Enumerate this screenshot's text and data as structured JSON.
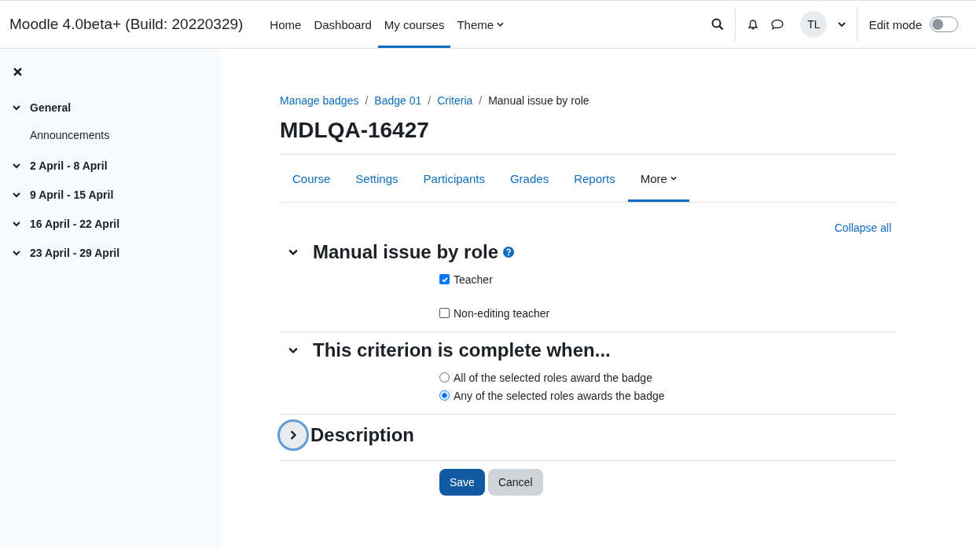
{
  "navbar": {
    "site_name": "Moodle 4.0beta+ (Build: 20220329)",
    "links": [
      {
        "label": "Home",
        "selected": false,
        "dropdown": false
      },
      {
        "label": "Dashboard",
        "selected": false,
        "dropdown": false
      },
      {
        "label": "My courses",
        "selected": true,
        "dropdown": false
      },
      {
        "label": "Theme",
        "selected": false,
        "dropdown": true
      }
    ],
    "avatar_initials": "TL",
    "edit_mode": {
      "label": "Edit mode",
      "on": false
    }
  },
  "drawer": {
    "items": [
      {
        "label": "General",
        "kind": "section",
        "expanded": true
      },
      {
        "label": "Announcements",
        "kind": "activity"
      },
      {
        "label": "2 April - 8 April",
        "kind": "section",
        "expanded": true
      },
      {
        "label": "9 April - 15 April",
        "kind": "section",
        "expanded": true
      },
      {
        "label": "16 April - 22 April",
        "kind": "section",
        "expanded": true
      },
      {
        "label": "23 April - 29 April",
        "kind": "section",
        "expanded": true
      }
    ]
  },
  "breadcrumb": [
    {
      "label": "Manage badges",
      "link": true
    },
    {
      "separator": "/",
      "label": "Badge 01",
      "link": true
    },
    {
      "separator": "/",
      "label": "Criteria",
      "link": true
    },
    {
      "separator": "/",
      "label": "Manual issue by role",
      "link": false
    }
  ],
  "page_title": "MDLQA-16427",
  "secondary_nav": [
    {
      "label": "Course",
      "selected": false,
      "dropdown": false
    },
    {
      "label": "Settings",
      "selected": false,
      "dropdown": false
    },
    {
      "label": "Participants",
      "selected": false,
      "dropdown": false
    },
    {
      "label": "Grades",
      "selected": false,
      "dropdown": false
    },
    {
      "label": "Reports",
      "selected": false,
      "dropdown": false
    },
    {
      "label": "More",
      "selected": true,
      "dropdown": true
    }
  ],
  "collapse_all": "Collapse all",
  "sections": [
    {
      "title": "Manual issue by role",
      "expanded": true,
      "focused": false,
      "help": true,
      "items": [
        {
          "kind": "checkbox",
          "label": "Teacher",
          "checked": true
        },
        {
          "kind": "checkbox",
          "label": "Non-editing teacher",
          "checked": false
        }
      ]
    },
    {
      "title": "This criterion is complete when...",
      "expanded": true,
      "focused": false,
      "items": [
        {
          "kind": "radio",
          "label": "All of the selected roles award the badge",
          "selected": false
        },
        {
          "kind": "radio",
          "label": "Any of the selected roles awards the badge",
          "selected": true
        }
      ]
    },
    {
      "title": "Description",
      "expanded": false,
      "focused": true
    }
  ],
  "buttons": [
    {
      "label": "Save",
      "kind": "primary"
    },
    {
      "label": "Cancel",
      "kind": "secondary"
    }
  ]
}
